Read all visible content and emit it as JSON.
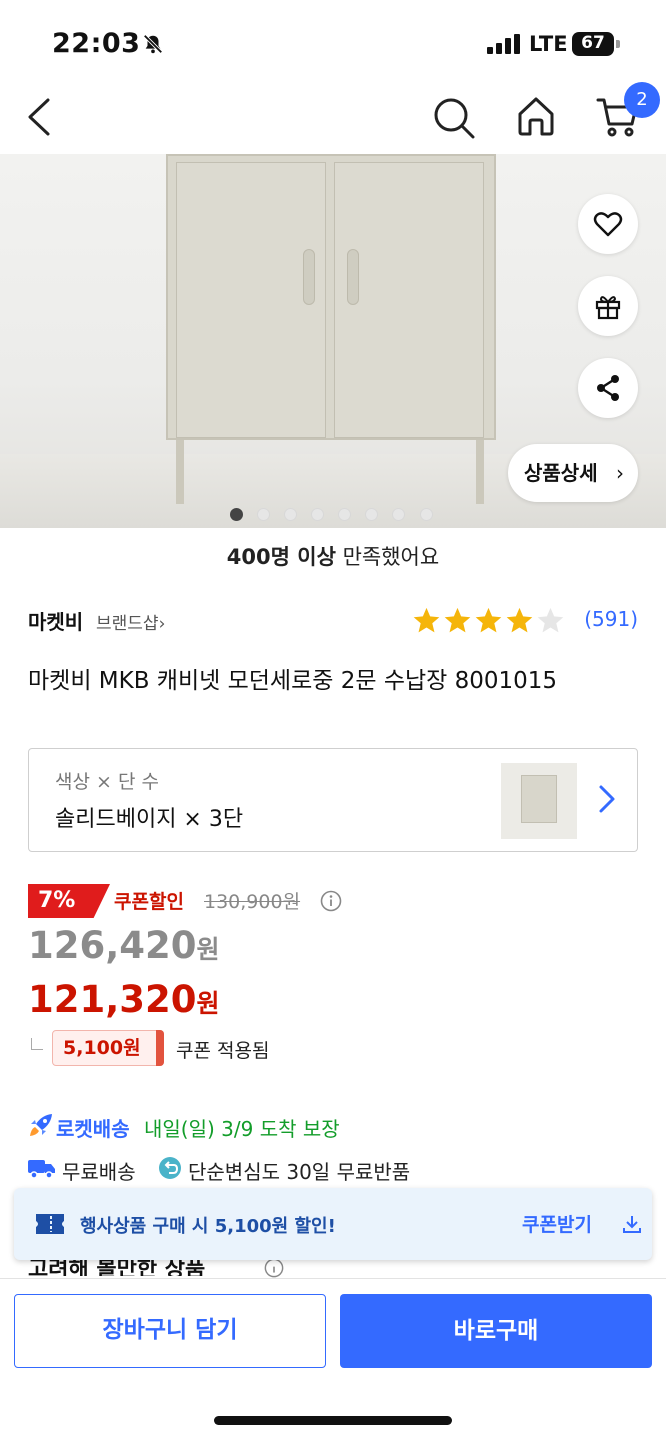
{
  "status_bar": {
    "time": "22:03",
    "network": "LTE",
    "battery": "67",
    "icons": [
      "bell-slash-icon",
      "signal-bars-icon",
      "battery-icon"
    ]
  },
  "nav": {
    "icons": [
      "back-chevron-icon",
      "search-icon",
      "home-icon",
      "cart-icon"
    ],
    "cart_badge": "2"
  },
  "hero": {
    "detail_button": "상품상세",
    "detail_chevron": "›",
    "page_count": 8,
    "active_page": 1,
    "action_icons": [
      "heart-icon",
      "gift-icon",
      "share-icon"
    ]
  },
  "satisfaction": {
    "count": "400명 이상",
    "text": "만족했어요"
  },
  "brand": {
    "name": "마켓비",
    "shop_link": "브랜드샵",
    "shop_chevron": "›",
    "rating": 4,
    "rating_max": 5,
    "review_count": "(591)"
  },
  "product": {
    "title": "마켓비 MKB 캐비넷 모던세로중 2문 수납장 8001015"
  },
  "option": {
    "label": "색상 × 단 수",
    "value": "솔리드베이지 × 3단"
  },
  "price": {
    "discount_pct": "7%",
    "coupon_discount_label": "쿠폰할인",
    "original": "130,900원",
    "sale_number": "126,420",
    "final_number": "121,320",
    "currency": "원",
    "coupon_amount": "5,100원",
    "coupon_applied": "쿠폰 적용됨"
  },
  "delivery": {
    "rocket_label": "로켓배송",
    "arrival": "내일(일) 3/9 도착 보장",
    "free_shipping": "무료배송",
    "free_return": "단순변심도 30일 무료반품"
  },
  "section": {
    "partial_heading": "고려해 볼만한 상품"
  },
  "coupon_banner": {
    "text": "행사상품 구매 시 5,100원 할인!",
    "action": "쿠폰받기"
  },
  "bottom": {
    "cart_button": "장바구니 담기",
    "buy_button": "바로구매"
  },
  "colors": {
    "accent_blue": "#346aff",
    "price_red": "#cb1400",
    "arrival_green": "#139d2a",
    "star_yellow": "#f5b50a"
  }
}
